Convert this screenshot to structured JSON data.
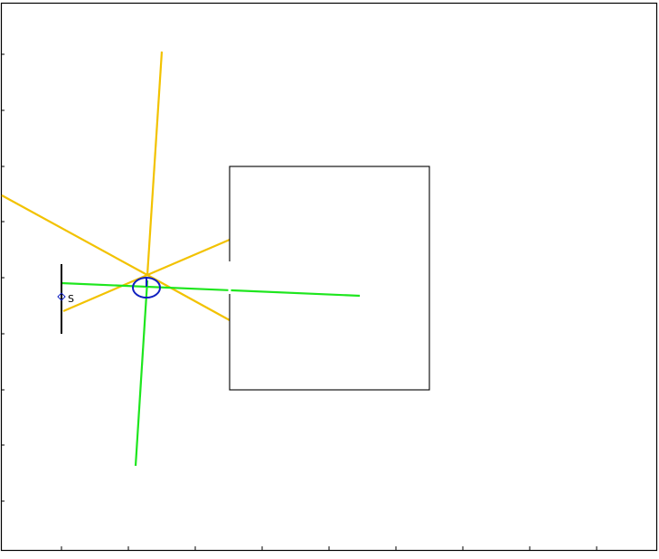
{
  "scene": {
    "source_label": "S",
    "colors": {
      "frame": "#000000",
      "obstacle": "#000000",
      "wall": "#000000",
      "ray_primary": "#f2c200",
      "ray_secondary": "#1ee61e",
      "agent": "#1020c0",
      "source_marker": "#1020c0"
    },
    "icons": {
      "agent": "circle-agent-icon",
      "source": "diamond-source-icon"
    }
  }
}
